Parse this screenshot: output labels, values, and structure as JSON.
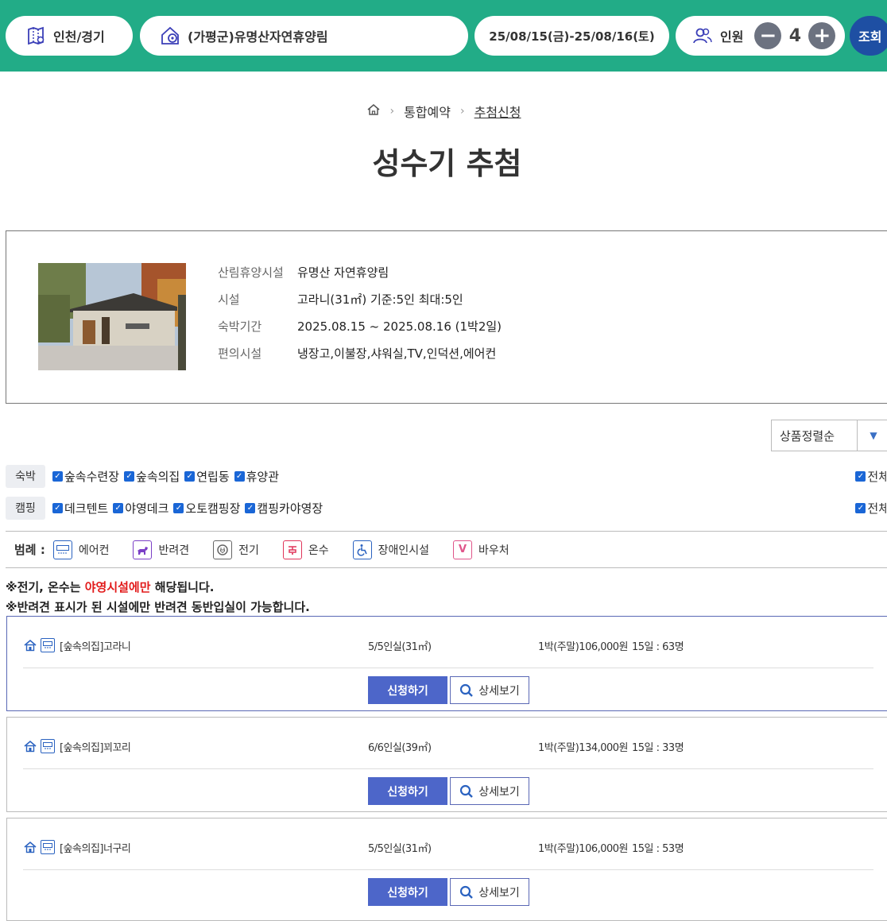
{
  "search": {
    "region": "인천/경기",
    "forest": "(가평군)유명산자연휴양림",
    "date_range": "25/08/15(금)-25/08/16(토)",
    "people_label": "인원",
    "people_count": "4",
    "minus": "−",
    "plus": "+",
    "search_button": "조회"
  },
  "breadcrumb": {
    "home": "홈",
    "items": [
      "통합예약",
      "추첨신청"
    ]
  },
  "page_title": "성수기 추첨",
  "facility": {
    "rows": [
      {
        "label": "산림휴양시설",
        "value": "유명산 자연휴양림"
      },
      {
        "label": "시설",
        "value": "고라니(31㎡) 기준:5인 최대:5인"
      },
      {
        "label": "숙박기간",
        "value": "2025.08.15 ~ 2025.08.16 (1박2일)"
      },
      {
        "label": "편의시설",
        "value": "냉장고,이불장,샤워실,TV,인덕션,에어컨"
      }
    ]
  },
  "sort": {
    "selected": "상품정렬순"
  },
  "filters": {
    "lodging": {
      "tag": "숙박",
      "items": [
        "숲속수련장",
        "숲속의집",
        "연립동",
        "휴양관"
      ],
      "all": "전체"
    },
    "camping": {
      "tag": "캠핑",
      "items": [
        "데크텐트",
        "야영데크",
        "오토캠핑장",
        "캠핑카야영장"
      ],
      "all": "전체"
    }
  },
  "legend": {
    "title": "범례 :",
    "items": [
      {
        "label": "에어컨",
        "icon": "aircon-icon",
        "color": "#2a62c0"
      },
      {
        "label": "반려견",
        "icon": "dog-icon",
        "color": "#7b3fc6"
      },
      {
        "label": "전기",
        "icon": "electric-icon",
        "color": "#666666"
      },
      {
        "label": "온수",
        "icon": "hotwater-icon",
        "color": "#e0355a"
      },
      {
        "label": "장애인시설",
        "icon": "accessibility-icon",
        "color": "#2a62c0"
      },
      {
        "label": "바우처",
        "icon": "voucher-icon",
        "color": "#e0558a"
      }
    ]
  },
  "notices": {
    "line1_prefix": "※전기, 온수는 ",
    "line1_highlight": "야영시설에만",
    "line1_suffix": " 해당됩니다.",
    "line2": "※반려견 표시가 된 시설에만 반려견 동반입실이 가능합니다."
  },
  "rooms": [
    {
      "name": "[숲속의집]고라니",
      "capacity": "5/5인실(31㎡)",
      "price": "1박(주말)106,000원",
      "lottery": "15일 : 63명"
    },
    {
      "name": "[숲속의집]꾀꼬리",
      "capacity": "6/6인실(39㎡)",
      "price": "1박(주말)134,000원",
      "lottery": "15일 : 33명"
    },
    {
      "name": "[숲속의집]너구리",
      "capacity": "5/5인실(31㎡)",
      "price": "1박(주말)106,000원",
      "lottery": "15일 : 53명"
    }
  ],
  "buttons": {
    "apply": "신청하기",
    "detail": "상세보기"
  },
  "colors": {
    "topbar": "#22ac87",
    "primary_button": "#4d66c9",
    "search_button": "#1e4fa3",
    "highlight": "#e21b1b"
  }
}
